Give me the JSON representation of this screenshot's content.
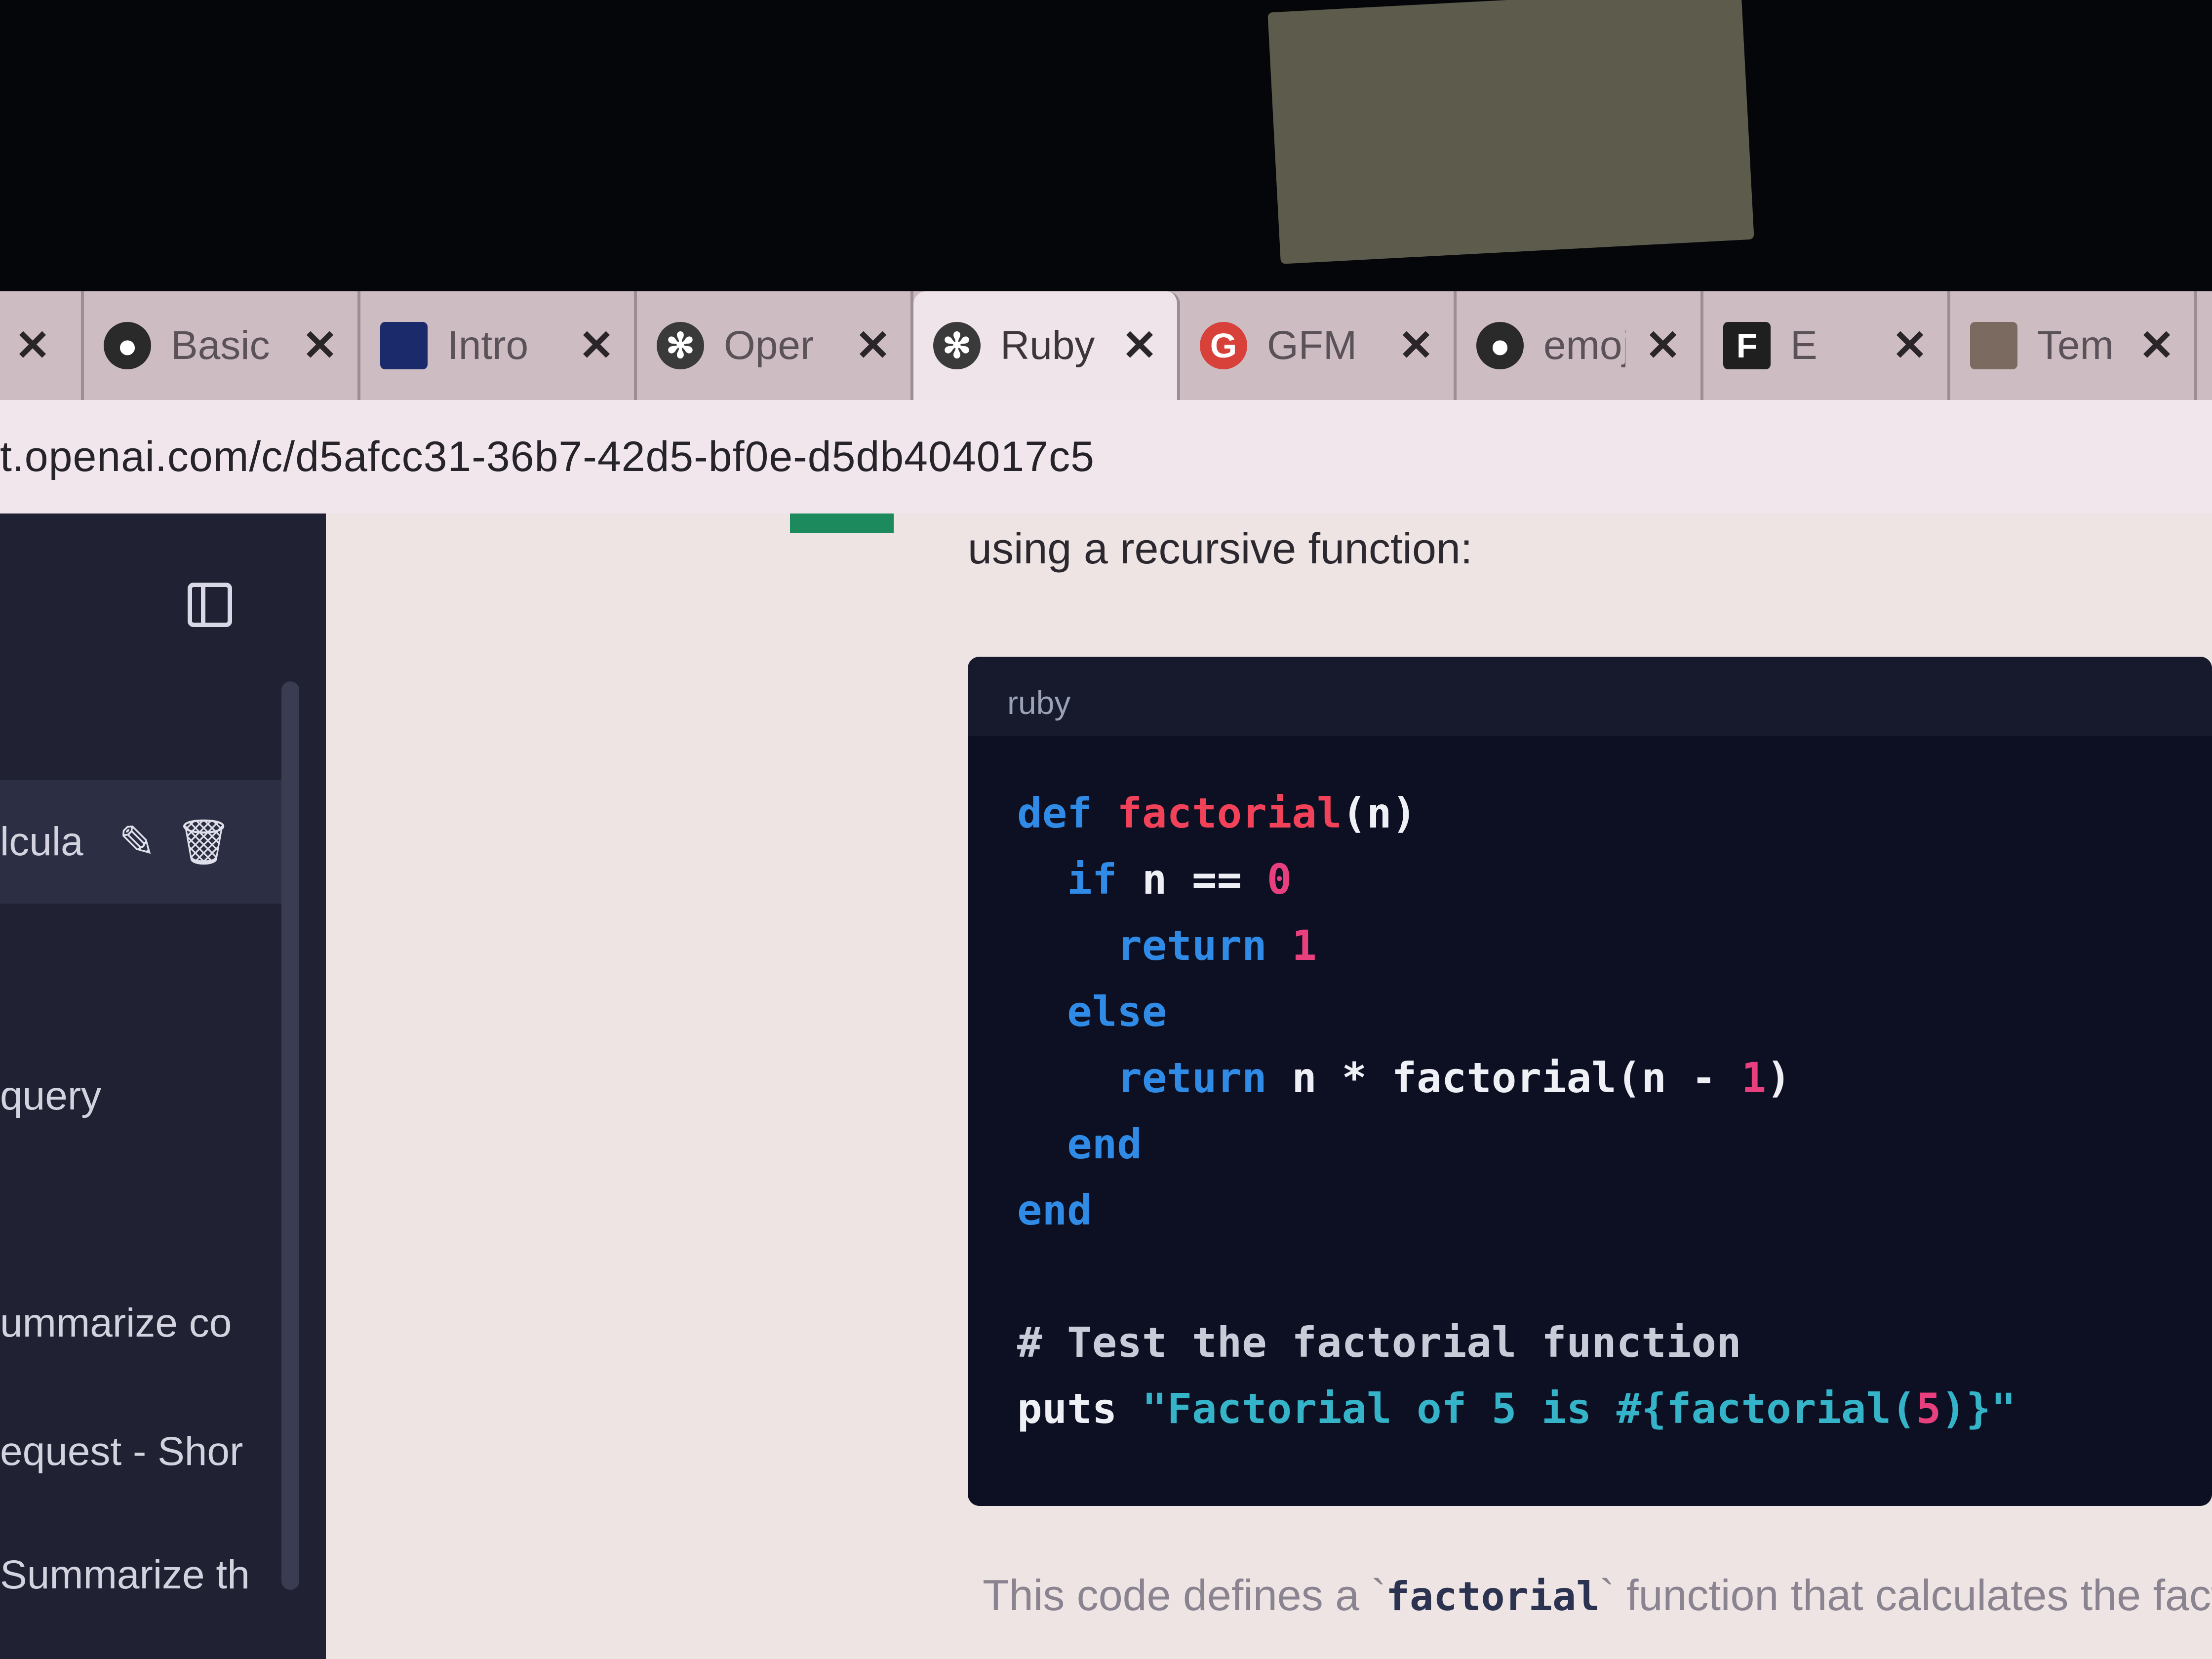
{
  "browser": {
    "tabs": [
      {
        "label": "",
        "icon": "close-icon",
        "active": false
      },
      {
        "label": "Basic",
        "icon": "github-icon",
        "active": false
      },
      {
        "label": "Intro",
        "icon": "site-icon",
        "active": false
      },
      {
        "label": "Oper",
        "icon": "openai-icon",
        "active": false
      },
      {
        "label": "Ruby",
        "icon": "openai-icon",
        "active": true
      },
      {
        "label": "GFM",
        "icon": "google-icon",
        "active": false
      },
      {
        "label": "emoj",
        "icon": "github-icon",
        "active": false
      },
      {
        "label": "E",
        "icon": "site-icon",
        "active": false
      },
      {
        "label": "Tem",
        "icon": "site-icon",
        "active": false
      }
    ],
    "close_glyph": "✕",
    "url": "t.openai.com/c/d5afcc31-36b7-42d5-bf0e-d5db404017c5"
  },
  "sidebar": {
    "items": [
      {
        "label": "lcula",
        "active": true
      },
      {
        "label": "query",
        "active": false
      },
      {
        "label": "ummarize co",
        "active": false
      },
      {
        "label": "equest - Shor",
        "active": false
      },
      {
        "label": "Summarize th",
        "active": false
      }
    ],
    "edit_glyph": "✎",
    "delete_glyph": "🗑"
  },
  "main": {
    "intro_text": "using a recursive function:",
    "code": {
      "language": "ruby",
      "lines": {
        "l1_kw": "def",
        "l1_fn": "factorial",
        "l1_rest": "(n)",
        "l2_kw": "  if",
        "l2_mid": " n == ",
        "l2_num": "0",
        "l3_kw": "    return",
        "l3_num": " 1",
        "l4_kw": "  else",
        "l5_kw": "    return",
        "l5_mid": " n * factorial(n - ",
        "l5_num": "1",
        "l5_end": ")",
        "l6_kw": "  end",
        "l7_kw": "end",
        "l9_cm": "# Test the factorial function",
        "l10_kw": "puts",
        "l10_str": " \"Factorial of 5 is #{factorial(",
        "l10_num": "5",
        "l10_str2": ")}\""
      }
    },
    "outro_pre": "This code defines a `",
    "outro_code": "factorial",
    "outro_post": "` function that calculates the factor"
  }
}
